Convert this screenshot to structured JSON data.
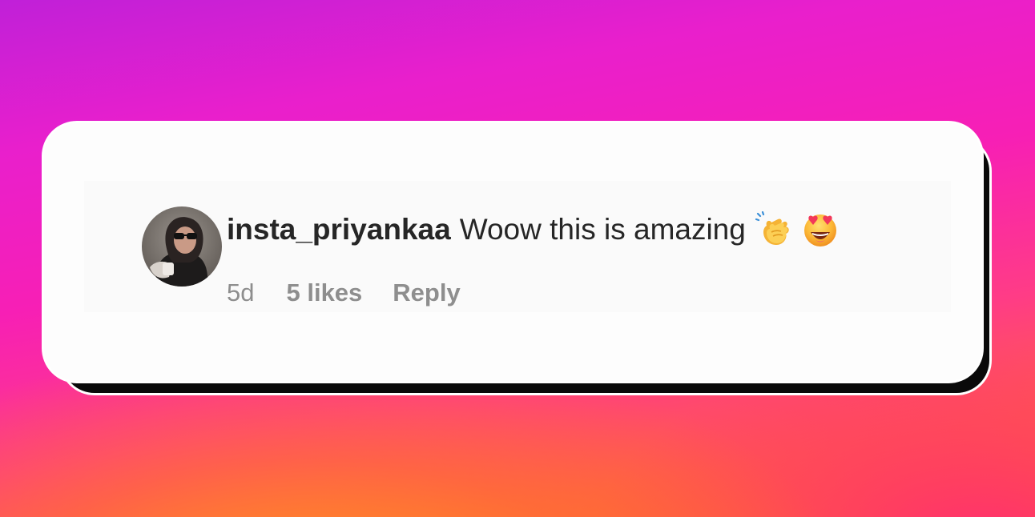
{
  "comment": {
    "username": "insta_priyankaa",
    "text": "Woow this is amazing",
    "emojis": [
      "clapping-hands-emoji",
      "heart-eyes-emoji"
    ],
    "time": "5d",
    "likes": "5 likes",
    "reply_label": "Reply"
  },
  "colors": {
    "text_primary": "#262626",
    "text_secondary": "#8e8e8e",
    "card_background": "#fdfdfd"
  }
}
